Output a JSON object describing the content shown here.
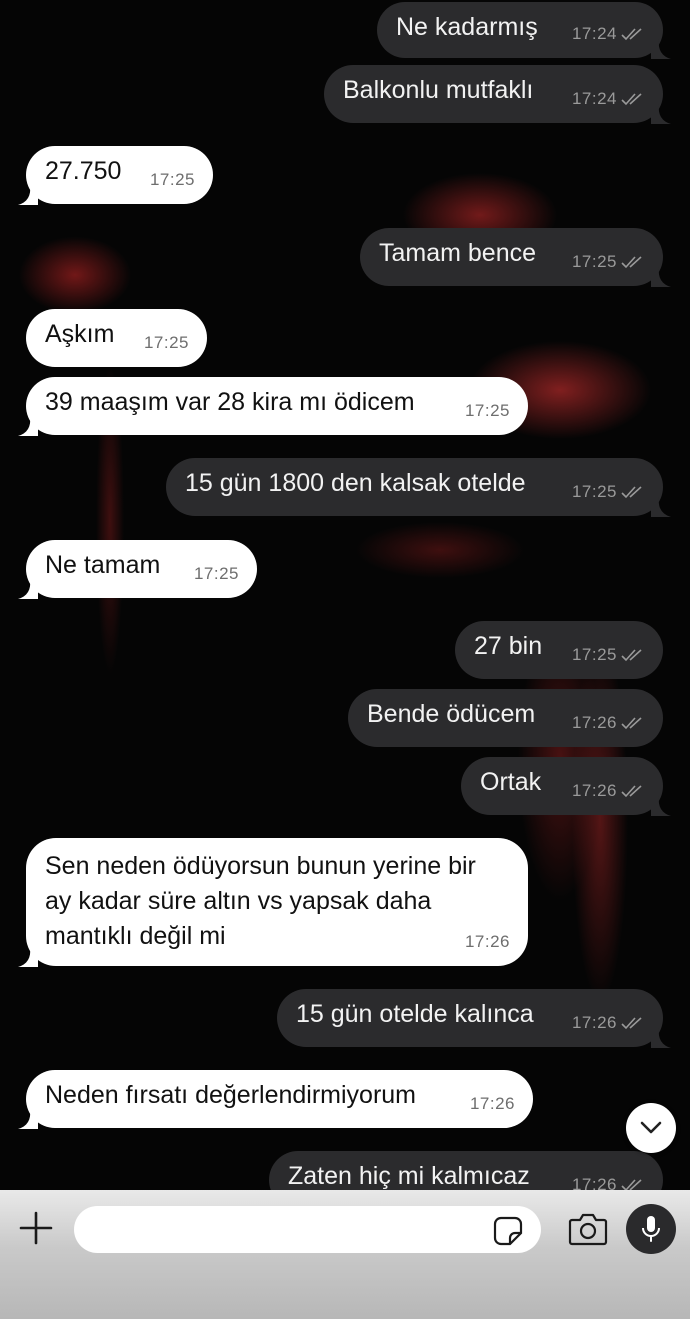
{
  "messages": [
    {
      "text": "Ne kadarmış",
      "time": "17:24",
      "direction": "out"
    },
    {
      "text": "Balkonlu mutfaklı",
      "time": "17:24",
      "direction": "out"
    },
    {
      "text": "27.750",
      "time": "17:25",
      "direction": "in"
    },
    {
      "text": "Tamam bence",
      "time": "17:25",
      "direction": "out"
    },
    {
      "text": "Aşkım",
      "time": "17:25",
      "direction": "in"
    },
    {
      "text": "39 maaşım var 28 kira mı ödicem",
      "time": "17:25",
      "direction": "in"
    },
    {
      "text": "15 gün 1800 den kalsak otelde",
      "time": "17:25",
      "direction": "out"
    },
    {
      "text": "Ne tamam",
      "time": "17:25",
      "direction": "in"
    },
    {
      "text": "27 bin",
      "time": "17:25",
      "direction": "out"
    },
    {
      "text": "Bende ödücem",
      "time": "17:26",
      "direction": "out"
    },
    {
      "text": "Ortak",
      "time": "17:26",
      "direction": "out"
    },
    {
      "text": "Sen neden ödüyorsun bunun yerine bir ay kadar süre altın vs yapsak daha mantıklı değil mi",
      "time": "17:26",
      "direction": "in"
    },
    {
      "text": "15 gün otelde kalınca",
      "time": "17:26",
      "direction": "out"
    },
    {
      "text": "Neden fırsatı değerlendirmiyorum",
      "time": "17:26",
      "direction": "in"
    },
    {
      "text": "Zaten hiç mi kalmıcaz",
      "time": "17:26",
      "direction": "out"
    }
  ],
  "composer": {
    "value": "",
    "placeholder": ""
  },
  "icons": {
    "add": "plus-icon",
    "sticker": "sticker-icon",
    "camera": "camera-icon",
    "mic": "microphone-icon",
    "scroll_down": "chevron-down-icon",
    "read_receipt": "double-check-icon"
  },
  "colors": {
    "incoming_bubble": "#ffffff",
    "outgoing_bubble": "#2b2b2d",
    "wallpaper": "#050505"
  }
}
